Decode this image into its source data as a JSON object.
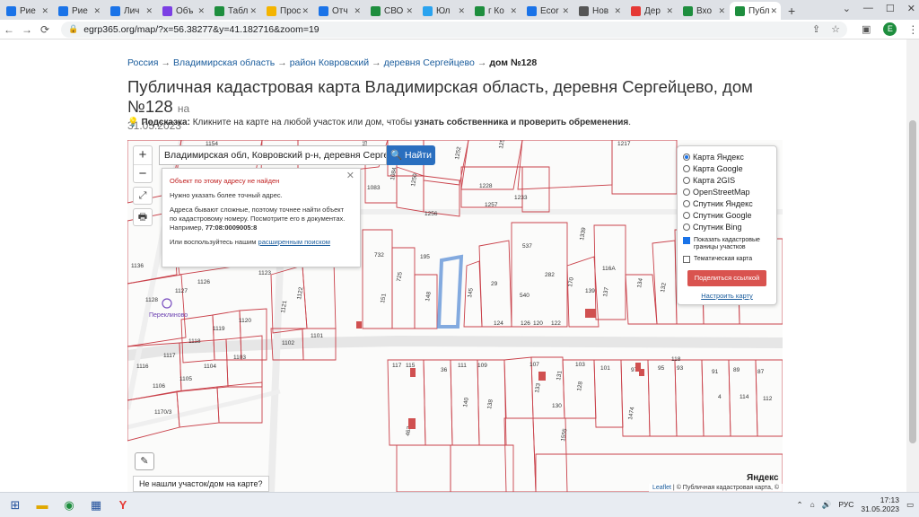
{
  "browser": {
    "tabs": [
      {
        "label": "Рие",
        "color": "#1a73e8"
      },
      {
        "label": "Рие",
        "color": "#1a73e8"
      },
      {
        "label": "Лич",
        "color": "#1a73e8"
      },
      {
        "label": "Объ",
        "color": "#7b3fe4"
      },
      {
        "label": "Табл",
        "color": "#1e8e3e"
      },
      {
        "label": "Прос",
        "color": "#f4b400"
      },
      {
        "label": "Отч",
        "color": "#1a73e8"
      },
      {
        "label": "СВО",
        "color": "#1e8e3e"
      },
      {
        "label": "Юл",
        "color": "#2aa3ef"
      },
      {
        "label": "г Ко",
        "color": "#1e8e3e"
      },
      {
        "label": "Ecor",
        "color": "#1a73e8"
      },
      {
        "label": "Нов",
        "color": "#555555"
      },
      {
        "label": "Дер",
        "color": "#e53935"
      },
      {
        "label": "Вхо",
        "color": "#1e8e3e"
      },
      {
        "label": "Публ",
        "color": "#1e8e3e"
      }
    ],
    "new_tab": "+",
    "url": "egrp365.org/map/?x=56.38277&y=41.182716&zoom=19",
    "avatar_letter": "E"
  },
  "page": {
    "breadcrumb": {
      "items": [
        "Россия",
        "Владимирская область",
        "район Ковровский",
        "деревня Сергейцево"
      ],
      "current": "дом №128",
      "separator": "→"
    },
    "title": "Публичная кадастровая карта Владимирская область, деревня Сергейцево, дом №128",
    "title_date_prefix": "на",
    "title_date": "31.05.2023",
    "hint_label": "Подсказка:",
    "hint_text": " Кликните на карте на любой участок или дом, чтобы ",
    "hint_bold": "узнать собственника и проверить обременения",
    "hint_end": "."
  },
  "map": {
    "zoom_in": "+",
    "zoom_out": "−",
    "search_value": "Владимирская обл, Ковровский р-н, деревня Сергейцево, д",
    "search_button": "Найти",
    "popup": {
      "error": "Объект по этому адресу не найден",
      "p1": "Нужно указать более точный адрес.",
      "p2": "Адреса бывают сложные, поэтому точнее найти объект по кадастровому номеру. Посмотрите его в документах. Например, ",
      "example": "77:08:0009005:8",
      "p3": "Или воспользуйтесь нашим ",
      "link": "расширенным поиском"
    },
    "layers": {
      "options": [
        "Карта Яндекс",
        "Карта Google",
        "Карта 2GIS",
        "OpenStreetMap",
        "Спутник Яндекс",
        "Спутник Google",
        "Спутник Bing"
      ],
      "selected": "Карта Яндекс",
      "show_boundaries": "Показать кадастровые границы участков",
      "thematic": "Тематическая карта",
      "share_button": "Поделиться ссылкой",
      "configure_link": "Настроить карту"
    },
    "not_found_button": "Не нашли участок/дом на карте?",
    "village_label": "Переклиново",
    "yandex_logo": "Яндекс",
    "attribution_leaflet": "Leaflet",
    "attribution_rest": " | © Публичная кадастровая карта, ©",
    "parcels": [
      {
        "n": "1154"
      },
      {
        "n": "1574"
      },
      {
        "n": "1252"
      },
      {
        "n": "1254"
      },
      {
        "n": "1217"
      },
      {
        "n": "1083"
      },
      {
        "n": "1084"
      },
      {
        "n": "1250"
      },
      {
        "n": "1233"
      },
      {
        "n": "1257"
      },
      {
        "n": "1256"
      },
      {
        "n": "1228"
      },
      {
        "n": "1136"
      },
      {
        "n": "1127"
      },
      {
        "n": "1126"
      },
      {
        "n": "1128"
      },
      {
        "n": "1123"
      },
      {
        "n": "1122"
      },
      {
        "n": "1121"
      },
      {
        "n": "732"
      },
      {
        "n": "195"
      },
      {
        "n": "725"
      },
      {
        "n": "151"
      },
      {
        "n": "148"
      },
      {
        "n": "145"
      },
      {
        "n": "29"
      },
      {
        "n": "537"
      },
      {
        "n": "282"
      },
      {
        "n": "540"
      },
      {
        "n": "1339"
      },
      {
        "n": "170"
      },
      {
        "n": "139"
      },
      {
        "n": "137"
      },
      {
        "n": "134"
      },
      {
        "n": "132"
      },
      {
        "n": "1119"
      },
      {
        "n": "1120"
      },
      {
        "n": "1118"
      },
      {
        "n": "1117"
      },
      {
        "n": "1116"
      },
      {
        "n": "1104"
      },
      {
        "n": "1103"
      },
      {
        "n": "1102"
      },
      {
        "n": "1101"
      },
      {
        "n": "1106"
      },
      {
        "n": "1105"
      },
      {
        "n": "1170/3"
      },
      {
        "n": "117"
      },
      {
        "n": "115"
      },
      {
        "n": "36"
      },
      {
        "n": "111"
      },
      {
        "n": "109"
      },
      {
        "n": "107"
      },
      {
        "n": "131"
      },
      {
        "n": "103"
      },
      {
        "n": "101"
      },
      {
        "n": "97"
      },
      {
        "n": "95"
      },
      {
        "n": "93"
      },
      {
        "n": "91"
      },
      {
        "n": "89"
      },
      {
        "n": "87"
      },
      {
        "n": "140"
      },
      {
        "n": "138"
      },
      {
        "n": "133"
      },
      {
        "n": "128"
      },
      {
        "n": "130"
      },
      {
        "n": "1474"
      },
      {
        "n": "118"
      },
      {
        "n": "4"
      },
      {
        "n": "114"
      },
      {
        "n": "112"
      },
      {
        "n": "1555"
      },
      {
        "n": "463"
      },
      {
        "n": "124"
      },
      {
        "n": "126"
      },
      {
        "n": "122"
      },
      {
        "n": "120"
      },
      {
        "n": "116A"
      }
    ]
  },
  "taskbar": {
    "lang": "РУС",
    "time": "17:13",
    "date": "31.05.2023"
  }
}
